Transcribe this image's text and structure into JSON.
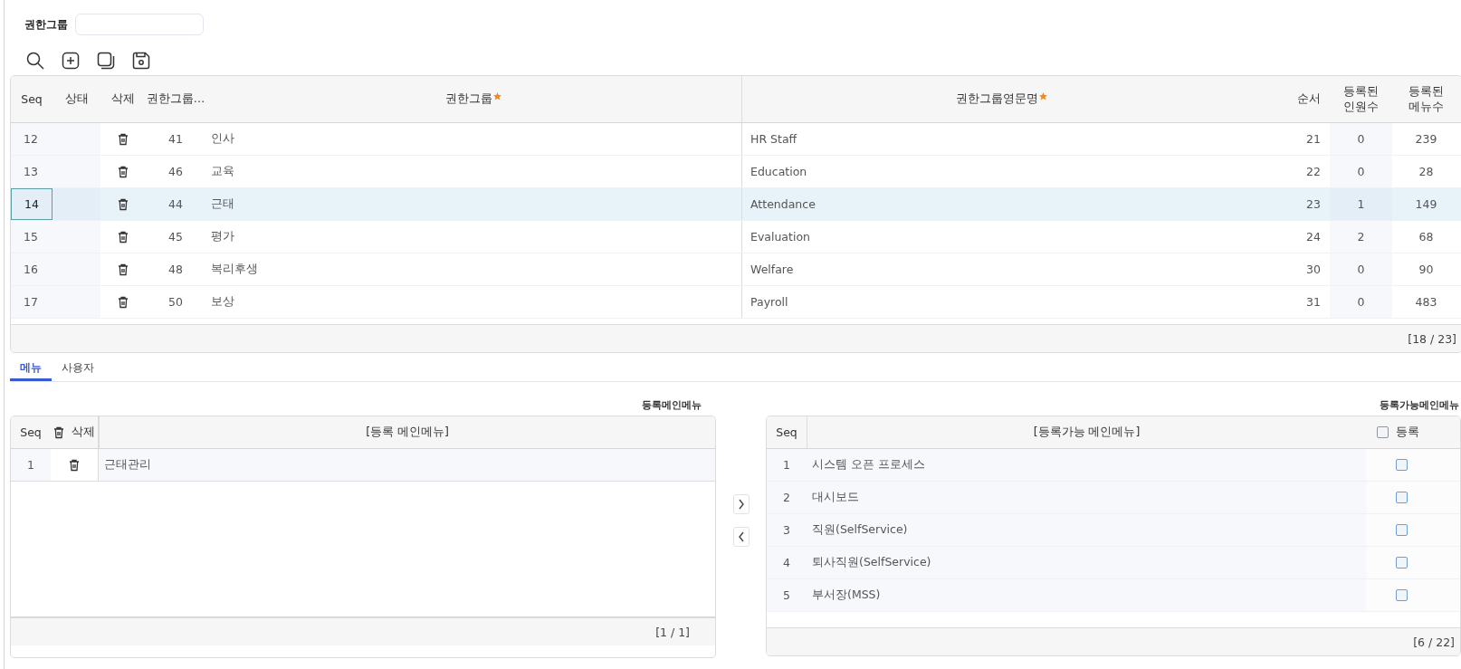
{
  "filter": {
    "label": "권한그룹"
  },
  "toolbar": [
    {
      "kind": "search"
    },
    {
      "kind": "add"
    },
    {
      "kind": "copy"
    },
    {
      "kind": "save"
    }
  ],
  "group_table": {
    "columns": [
      {
        "label": "Seq",
        "required": false
      },
      {
        "label": "상태",
        "required": false
      },
      {
        "label": "삭제",
        "required": false
      },
      {
        "label": "권한그룹…",
        "required": false
      },
      {
        "label": "권한그룹",
        "required": true
      },
      {
        "label": "권한그룹영문명",
        "required": true
      },
      {
        "label": "순서",
        "required": false
      },
      {
        "label": "등록된 인원수",
        "required": false
      },
      {
        "label": "등록된 메뉴수",
        "required": false
      }
    ],
    "rows": [
      {
        "seq": "12",
        "group_id": "41",
        "name": "인사",
        "english_name": "HR Staff",
        "order": "21",
        "users": "0",
        "menus": "239",
        "selected": false
      },
      {
        "seq": "13",
        "group_id": "46",
        "name": "교육",
        "english_name": "Education",
        "order": "22",
        "users": "0",
        "menus": "28",
        "selected": false
      },
      {
        "seq": "14",
        "group_id": "44",
        "name": "근태",
        "english_name": "Attendance",
        "order": "23",
        "users": "1",
        "menus": "149",
        "selected": true
      },
      {
        "seq": "15",
        "group_id": "45",
        "name": "평가",
        "english_name": "Evaluation",
        "order": "24",
        "users": "2",
        "menus": "68",
        "selected": false
      },
      {
        "seq": "16",
        "group_id": "48",
        "name": "복리후생",
        "english_name": "Welfare",
        "order": "30",
        "users": "0",
        "menus": "90",
        "selected": false
      },
      {
        "seq": "17",
        "group_id": "50",
        "name": "보상",
        "english_name": "Payroll",
        "order": "31",
        "users": "0",
        "menus": "483",
        "selected": false
      }
    ],
    "footer": "[18 / 23]"
  },
  "tabs": [
    {
      "label": "메뉴",
      "selected": true
    },
    {
      "label": "사용자",
      "selected": false
    }
  ],
  "registered_menu": {
    "title": "등록메인메뉴",
    "columns": [
      "Seq",
      "삭제",
      "[등록 메인메뉴]"
    ],
    "rows": [
      {
        "seq": "1",
        "name": "근태관리"
      }
    ],
    "footer": "[1 / 1]"
  },
  "transfer_buttons": [
    {
      "kind": "right"
    },
    {
      "kind": "left"
    }
  ],
  "available_menu": {
    "title": "등록가능메인메뉴",
    "columns": [
      "Seq",
      "[등록가능 메인메뉴]",
      "등록"
    ],
    "select_all_checked": false,
    "rows": [
      {
        "seq": "1",
        "name": "시스템 오픈 프로세스",
        "checked": false
      },
      {
        "seq": "2",
        "name": "대시보드",
        "checked": false
      },
      {
        "seq": "3",
        "name": "직원(SelfService)",
        "checked": false
      },
      {
        "seq": "4",
        "name": "퇴사직원(SelfService)",
        "checked": false
      },
      {
        "seq": "5",
        "name": "부서장(MSS)",
        "checked": false
      }
    ],
    "footer": "[6 / 22]"
  }
}
